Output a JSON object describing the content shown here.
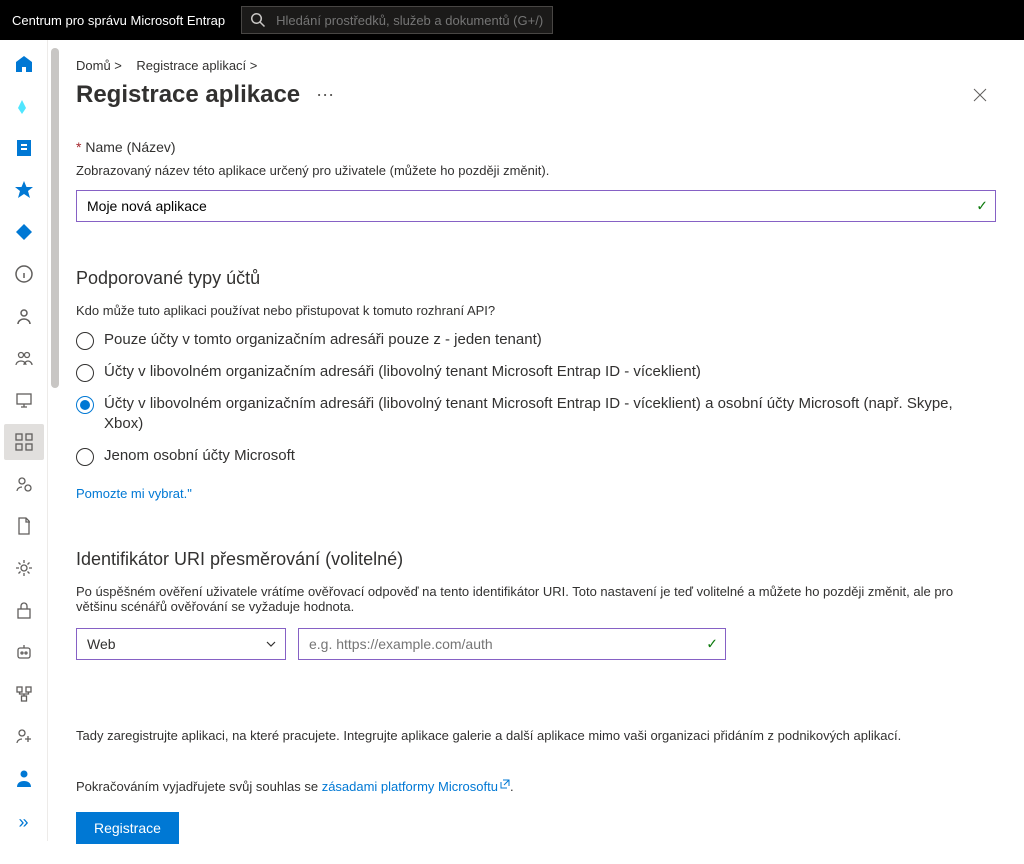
{
  "topbar": {
    "brand": "Centrum pro správu Microsoft Entrap",
    "search_placeholder": "Hledání prostředků, služeb a dokumentů (G+/)"
  },
  "breadcrumb": {
    "home": "Domů >",
    "apps": "Registrace aplikací >"
  },
  "title": "Registrace aplikace",
  "name_section": {
    "label": "Name (Název)",
    "help": "Zobrazovaný název této aplikace určený pro uživatele (můžete ho později změnit).",
    "value": "Moje nová aplikace"
  },
  "accounts": {
    "heading": "Podporované typy účtů",
    "help": "Kdo může tuto aplikaci používat nebo přistupovat k tomuto rozhraní API?",
    "options": [
      "Pouze účty v tomto organizačním adresáři         pouze z - jeden tenant)",
      "Účty v libovolném organizačním adresáři (libovolný tenant Microsoft Entrap ID - víceklient)",
      "Účty v libovolném organizačním adresáři (libovolný tenant Microsoft Entrap ID - víceklient) a osobní účty Microsoft (např. Skype, Xbox)",
      "Jenom osobní účty Microsoft"
    ],
    "selected": 2,
    "help_link": "Pomozte mi vybrat.\""
  },
  "redirect": {
    "heading": "Identifikátor URI přesměrování (volitelné)",
    "help": "Po úspěšném ověření uživatele vrátíme ověřovací odpověď na tento identifikátor URI. Toto nastavení je teď volitelné a můžete ho později změnit, ale pro většinu scénářů ověřování se vyžaduje hodnota.",
    "platform": "Web",
    "uri_placeholder": "e.g. https://example.com/auth"
  },
  "footer_note": "Tady zaregistrujte aplikaci, na které pracujete. Integrujte aplikace galerie a další aplikace mimo vaši organizaci přidáním z podnikových aplikací.",
  "consent_prefix": "Pokračováním vyjadřujete svůj souhlas se ",
  "consent_link": "zásadami platformy Microsoftu",
  "consent_suffix": ".",
  "register_button": "Registrace"
}
